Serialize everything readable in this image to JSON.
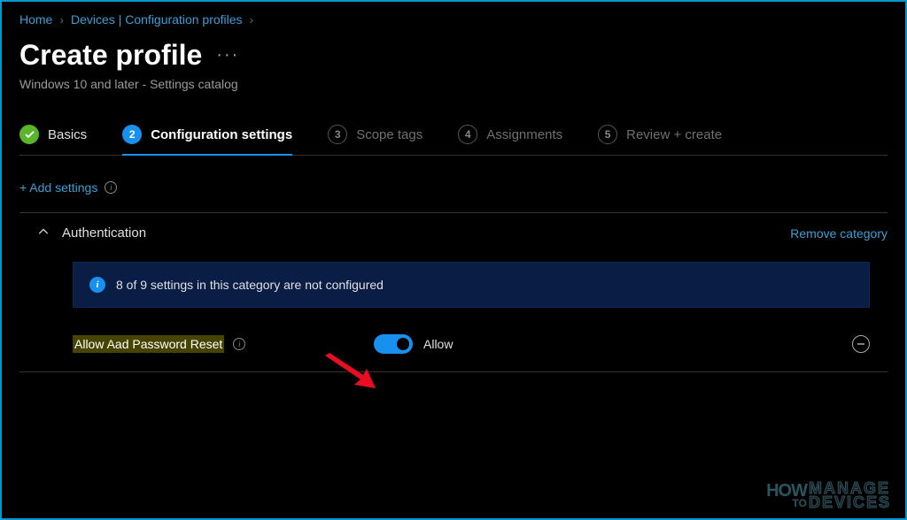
{
  "breadcrumb": {
    "items": [
      "Home",
      "Devices | Configuration profiles"
    ]
  },
  "header": {
    "title": "Create profile",
    "subtitle": "Windows 10 and later - Settings catalog"
  },
  "tabs": {
    "items": [
      {
        "num": "1",
        "label": "Basics",
        "state": "completed"
      },
      {
        "num": "2",
        "label": "Configuration settings",
        "state": "active"
      },
      {
        "num": "3",
        "label": "Scope tags",
        "state": "pending"
      },
      {
        "num": "4",
        "label": "Assignments",
        "state": "pending"
      },
      {
        "num": "5",
        "label": "Review + create",
        "state": "pending"
      }
    ]
  },
  "actions": {
    "add_settings": "+ Add settings"
  },
  "category": {
    "name": "Authentication",
    "remove": "Remove category",
    "banner": "8 of 9 settings in this category are not configured",
    "setting": {
      "label": "Allow Aad Password Reset",
      "toggle_value": "Allow"
    }
  },
  "watermark": {
    "how": "HOW",
    "to": "TO",
    "manage": "MANAGE",
    "devices": "DEVICES"
  }
}
